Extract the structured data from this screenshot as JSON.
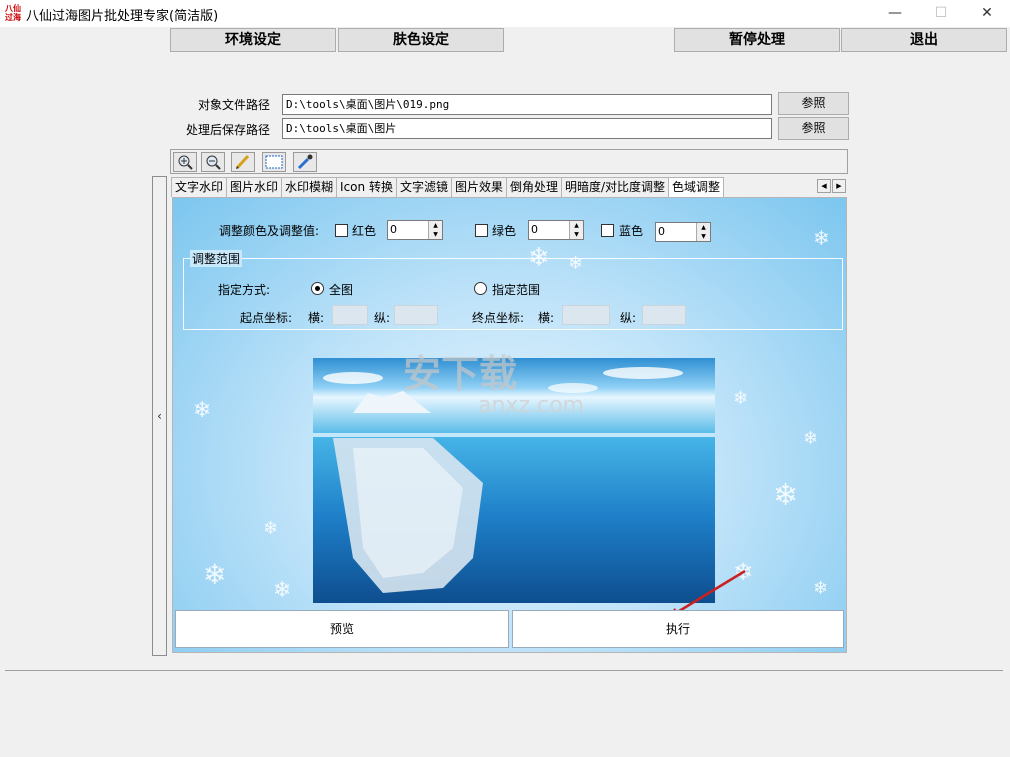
{
  "window": {
    "title": "八仙过海图片批处理专家(简洁版)",
    "icon_text": "八仙 过海",
    "controls": {
      "minimize": "—",
      "maximize": "☐",
      "close": "✕"
    }
  },
  "top_buttons": {
    "env": "环境设定",
    "skin": "肤色设定",
    "pause": "暂停处理",
    "exit": "退出"
  },
  "paths": {
    "source_label": "对象文件路径",
    "source_value": "D:\\tools\\桌面\\图片\\019.png",
    "save_label": "处理后保存路径",
    "save_value": "D:\\tools\\桌面\\图片",
    "browse_label": "参照"
  },
  "toolbar": {
    "tools": [
      "zoom-in-icon",
      "zoom-out-icon",
      "pencil-icon",
      "select-rect-icon",
      "eyedropper-icon"
    ]
  },
  "tabs": [
    "文字水印",
    "图片水印",
    "水印模糊",
    "Icon 转换",
    "文字滤镜",
    "图片效果",
    "倒角处理",
    "明暗度/对比度调整",
    "色域调整"
  ],
  "active_tab": "色域调整",
  "collapse_arrow": "‹",
  "color_adjust": {
    "label": "调整颜色及调整值:",
    "red": {
      "label": "红色",
      "value": "0",
      "checked": false
    },
    "green": {
      "label": "绿色",
      "value": "0",
      "checked": false
    },
    "blue": {
      "label": "蓝色",
      "value": "0",
      "checked": false
    }
  },
  "range": {
    "group_title": "调整范围",
    "mode_label": "指定方式:",
    "full": "全图",
    "custom": "指定范围",
    "start_label": "起点坐标:",
    "end_label": "终点坐标:",
    "horiz": "横:",
    "vert": "纵:",
    "selected": "全图"
  },
  "watermark": {
    "brand": "安下载",
    "url": "anxz.com"
  },
  "actions": {
    "preview": "预览",
    "execute": "执行"
  },
  "accent_color": "#cc1f1f"
}
